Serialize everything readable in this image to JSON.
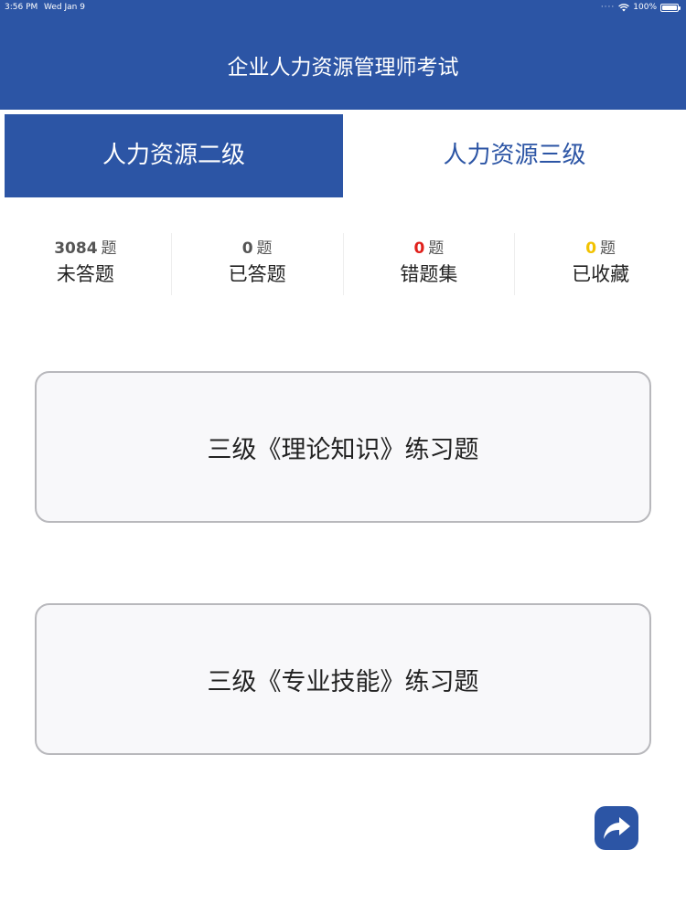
{
  "status_bar": {
    "time": "3:56 PM",
    "date": "Wed Jan 9",
    "battery": "100%"
  },
  "header": {
    "title": "企业人力资源管理师考试"
  },
  "tabs": [
    {
      "label": "人力资源二级",
      "active": true
    },
    {
      "label": "人力资源三级",
      "active": false
    }
  ],
  "stats": [
    {
      "count": "3084",
      "unit": "题",
      "label": "未答题",
      "color": "#555555"
    },
    {
      "count": "0",
      "unit": "题",
      "label": "已答题",
      "color": "#555555"
    },
    {
      "count": "0",
      "unit": "题",
      "label": "错题集",
      "color": "#e0201b"
    },
    {
      "count": "0",
      "unit": "题",
      "label": "已收藏",
      "color": "#f2c200"
    }
  ],
  "practice": [
    {
      "label": "三级《理论知识》练习题"
    },
    {
      "label": "三级《专业技能》练习题"
    }
  ],
  "colors": {
    "primary": "#2c55a5",
    "card_bg": "#f8f8fa",
    "card_border": "#b8b8bc"
  },
  "icons": {
    "share": "share-arrow-icon",
    "wifi": "wifi-icon",
    "battery": "battery-icon"
  }
}
